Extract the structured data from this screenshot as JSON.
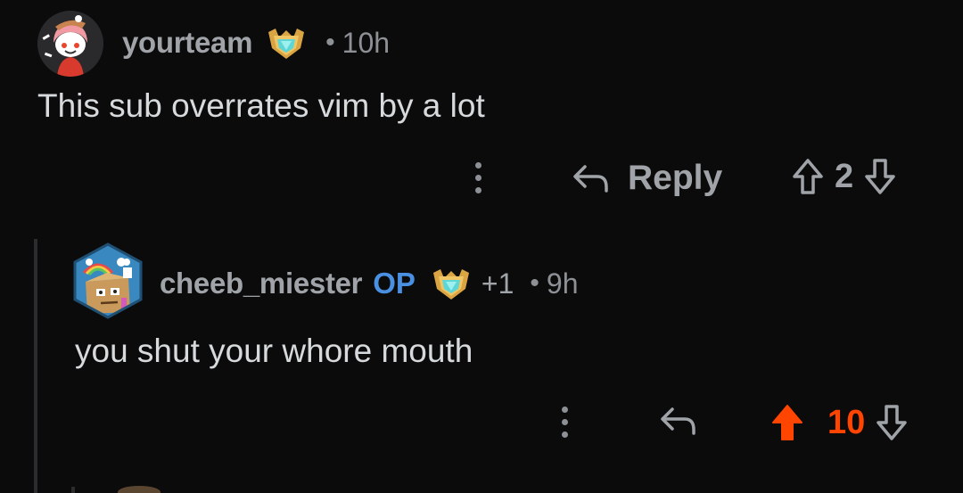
{
  "comments": [
    {
      "username": "yourteam",
      "time_separator": "•",
      "time": "10h",
      "body": "This sub overrates vim by a lot",
      "actions": {
        "reply_label": "Reply",
        "vote_count": "2",
        "upvoted": false
      },
      "icons": {
        "avatar": "snoo-avatar-icon",
        "award": "diamond-award-icon",
        "more": "more-options-icon",
        "reply": "reply-arrow-icon",
        "upvote": "upvote-arrow-icon",
        "downvote": "downvote-arrow-icon"
      }
    },
    {
      "username": "cheeb_miester",
      "op_badge": "OP",
      "award_count": "+1",
      "time_separator": "•",
      "time": "9h",
      "body": "you shut your whore mouth",
      "actions": {
        "vote_count": "10",
        "upvoted": true
      },
      "icons": {
        "avatar": "box-character-avatar-icon",
        "award": "diamond-award-icon",
        "more": "more-options-icon",
        "reply": "reply-arrow-icon",
        "upvote": "upvote-arrow-icon",
        "downvote": "downvote-arrow-icon"
      }
    }
  ],
  "colors": {
    "background": "#0b0b0c",
    "text": "#d7dadc",
    "meta": "#a0a4a8",
    "op_blue": "#4a90e2",
    "upvote_orange": "#ff4500"
  }
}
